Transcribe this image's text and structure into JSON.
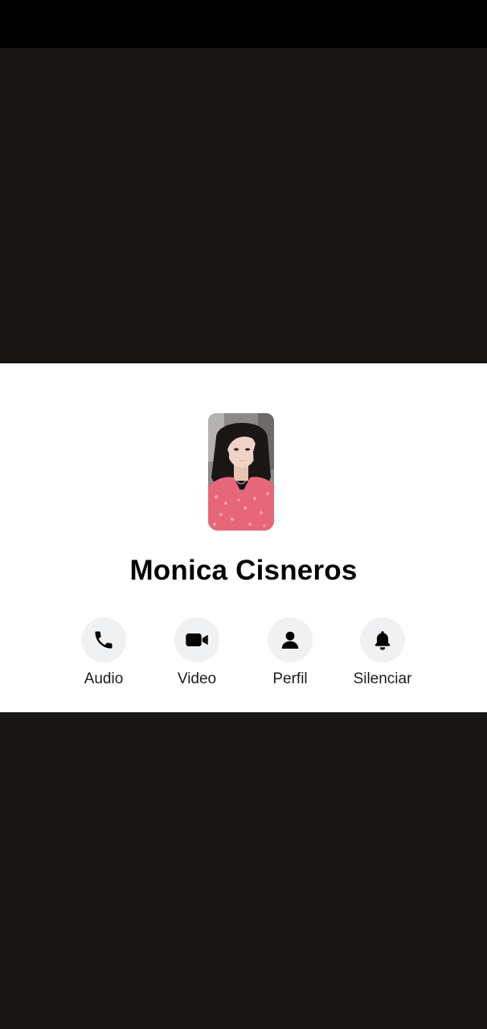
{
  "contact": {
    "name": "Monica Cisneros",
    "avatar_alt": "profile-photo"
  },
  "actions": [
    {
      "label": "Audio",
      "icon": "phone-icon"
    },
    {
      "label": "Video",
      "icon": "video-camera-icon"
    },
    {
      "label": "Perfil",
      "icon": "person-icon"
    },
    {
      "label": "Silenciar",
      "icon": "bell-icon"
    }
  ],
  "colors": {
    "card_background": "#ffffff",
    "backdrop": "#171615",
    "status_bar": "#000000",
    "action_circle": "#f0f1f3",
    "text": "#050505"
  }
}
